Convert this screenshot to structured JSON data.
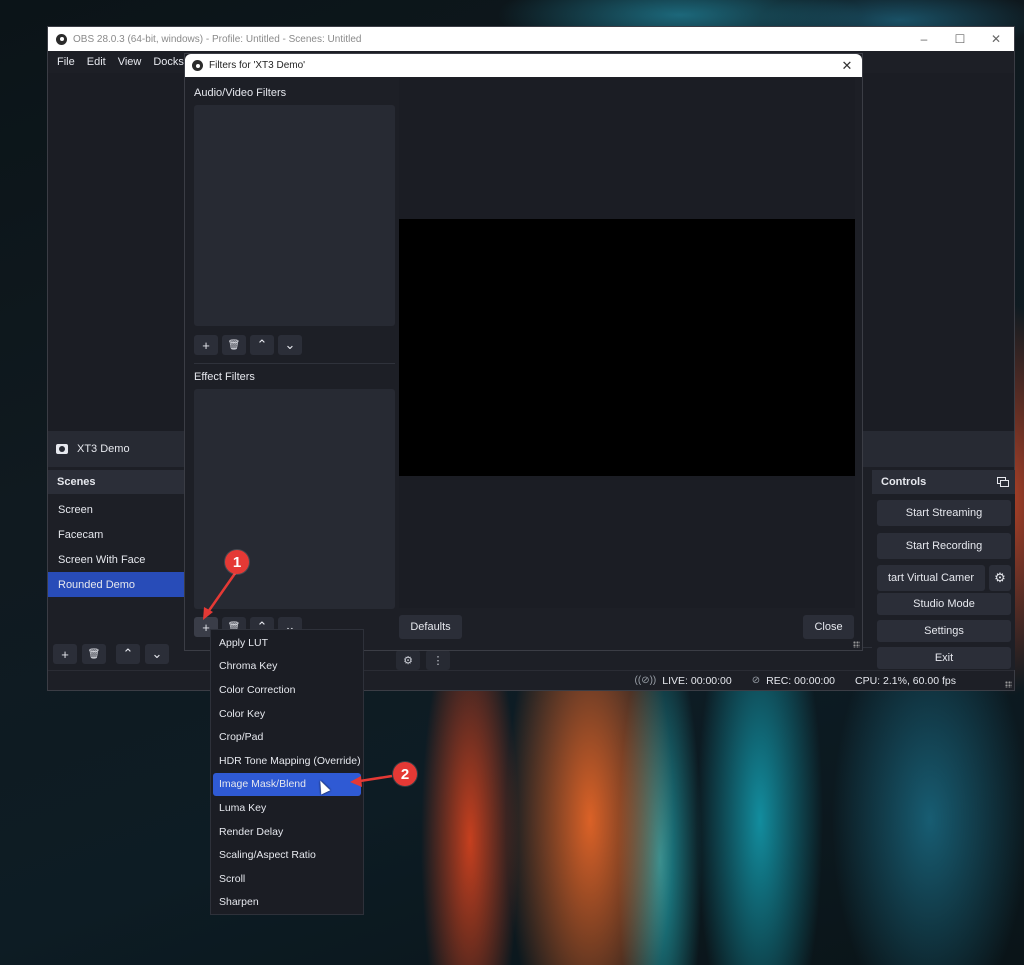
{
  "main_window": {
    "title": "OBS 28.0.3 (64-bit, windows) - Profile: Untitled - Scenes: Untitled",
    "controls": {
      "minimize": "–",
      "maximize": "☐",
      "close": "✕"
    },
    "menu": [
      "File",
      "Edit",
      "View",
      "Docks"
    ]
  },
  "source_bar": {
    "source_name": "XT3 Demo"
  },
  "scenes": {
    "header": "Scenes",
    "items": [
      {
        "label": "Screen",
        "active": false
      },
      {
        "label": "Facecam",
        "active": false
      },
      {
        "label": "Screen With Face",
        "active": false
      },
      {
        "label": "Rounded Demo",
        "active": true
      }
    ],
    "toolbar": {
      "add": "+",
      "remove": "🗑",
      "up": "⌃",
      "down": "⌄"
    }
  },
  "controls": {
    "header": "Controls",
    "buttons": {
      "start_streaming": "Start Streaming",
      "start_recording": "Start Recording",
      "start_virtual_camera": "tart Virtual Camer",
      "studio_mode": "Studio Mode",
      "settings": "Settings",
      "exit": "Exit"
    }
  },
  "mixer": {
    "gear": "⚙",
    "more": "⋮"
  },
  "status_bar": {
    "live": "LIVE: 00:00:00",
    "rec": "REC: 00:00:00",
    "cpu": "CPU: 2.1%, 60.00 fps"
  },
  "filters_dialog": {
    "title": "Filters for 'XT3 Demo'",
    "close_glyph": "✕",
    "audio_video_label": "Audio/Video Filters",
    "effect_label": "Effect Filters",
    "toolbar": {
      "add": "+",
      "remove": "🗑",
      "up": "⌃",
      "down": "⌄"
    },
    "defaults_button": "Defaults",
    "close_button": "Close"
  },
  "context_menu": {
    "items": [
      {
        "label": "Apply LUT",
        "highlighted": false
      },
      {
        "label": "Chroma Key",
        "highlighted": false
      },
      {
        "label": "Color Correction",
        "highlighted": false
      },
      {
        "label": "Color Key",
        "highlighted": false
      },
      {
        "label": "Crop/Pad",
        "highlighted": false
      },
      {
        "label": "HDR Tone Mapping (Override)",
        "highlighted": false
      },
      {
        "label": "Image Mask/Blend",
        "highlighted": true
      },
      {
        "label": "Luma Key",
        "highlighted": false
      },
      {
        "label": "Render Delay",
        "highlighted": false
      },
      {
        "label": "Scaling/Aspect Ratio",
        "highlighted": false
      },
      {
        "label": "Scroll",
        "highlighted": false
      },
      {
        "label": "Sharpen",
        "highlighted": false
      }
    ]
  },
  "annotations": {
    "step1": "1",
    "step2": "2",
    "color": "#e53935"
  },
  "colors": {
    "accent": "#284cb8",
    "menu_highlight": "#2f5ad4",
    "panel_bg": "#1d1f26",
    "button_bg": "#2b2e38"
  }
}
